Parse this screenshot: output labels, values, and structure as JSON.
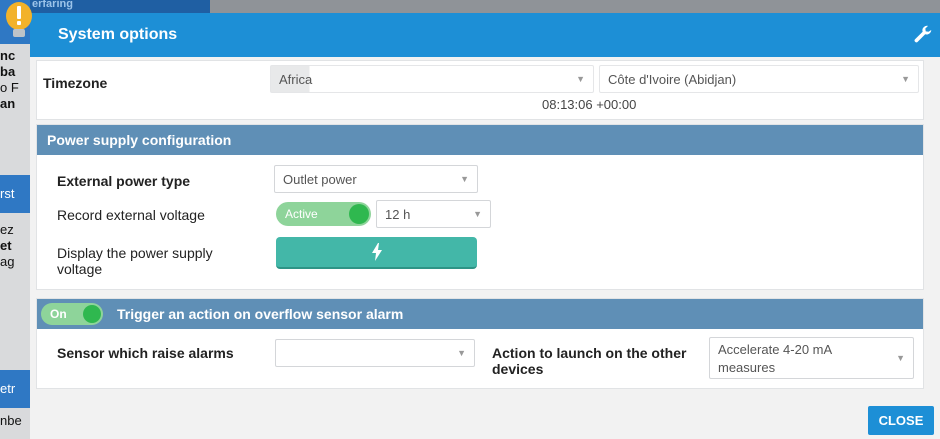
{
  "background": {
    "fragments": [
      "erfaring",
      "nc",
      "ba",
      "o F",
      "an",
      "rst",
      "ez",
      "et",
      "ag",
      "etr",
      "nbe"
    ]
  },
  "dialog": {
    "title": "System options",
    "timezone": {
      "label": "Timezone",
      "region": "Africa",
      "city": "Côte d'Ivoire (Abidjan)",
      "time": "08:13:06 +00:00"
    },
    "power": {
      "header": "Power supply configuration",
      "external_type_label": "External power type",
      "external_type_value": "Outlet power",
      "record_label": "Record external voltage",
      "record_toggle": "Active",
      "record_interval": "12 h",
      "display_label_line1": "Display the power supply",
      "display_label_line2": "voltage",
      "display_button_icon": "lightning-bolt-icon"
    },
    "overflow": {
      "toggle": "On",
      "header": "Trigger an action on overflow sensor alarm",
      "sensor_label": "Sensor which raise alarms",
      "sensor_value": "",
      "action_label_line1": "Action to launch on the other",
      "action_label_line2": "devices",
      "action_value_line1": "Accelerate 4-20 mA",
      "action_value_line2": "measures"
    },
    "close_label": "CLOSE"
  },
  "colors": {
    "titlebar": "#1d8fd6",
    "section_header": "#5f8fb6",
    "toggle_on": "#2fb84f",
    "voltage_button": "#43b7a8"
  }
}
